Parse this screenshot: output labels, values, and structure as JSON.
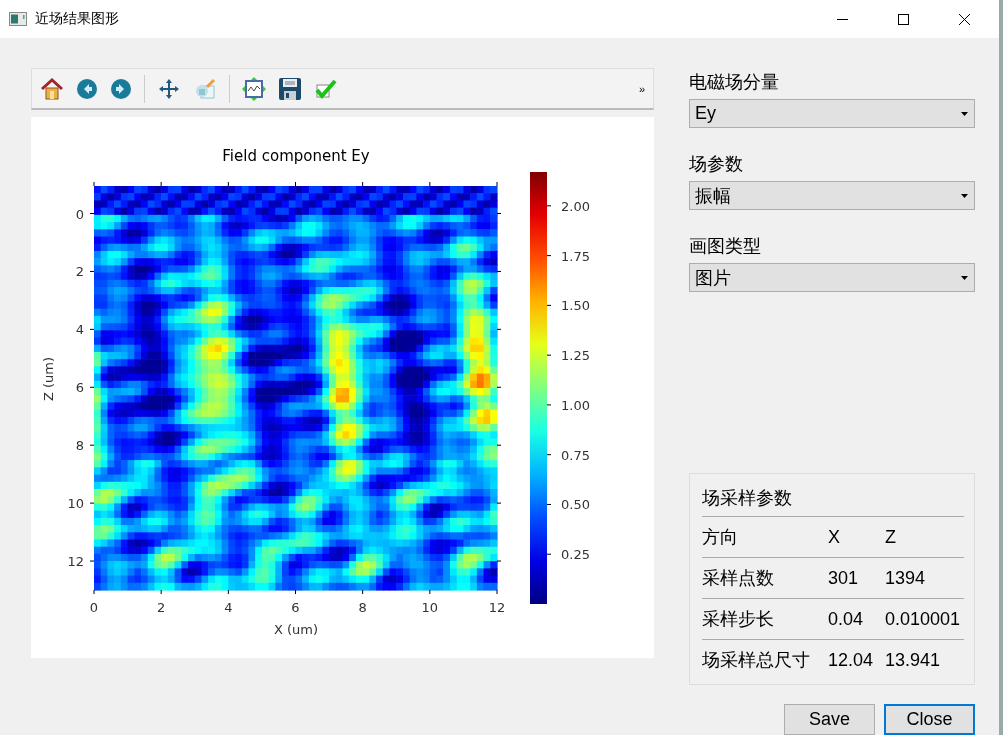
{
  "window": {
    "title": "近场结果图形"
  },
  "toolbar": {
    "items": [
      {
        "kind": "home"
      },
      {
        "kind": "back"
      },
      {
        "kind": "forward"
      },
      {
        "kind": "separator"
      },
      {
        "kind": "pan"
      },
      {
        "kind": "edit"
      },
      {
        "kind": "separator"
      },
      {
        "kind": "subplots"
      },
      {
        "kind": "save"
      },
      {
        "kind": "check"
      }
    ],
    "overflow": "»"
  },
  "plot": {
    "title": "Field component Ey",
    "xlabel": "X (um)",
    "ylabel": "Z (um)",
    "xticks": [
      "0",
      "2",
      "4",
      "6",
      "8",
      "10",
      "12"
    ],
    "yticks": [
      "0",
      "2",
      "4",
      "6",
      "8",
      "10",
      "12"
    ],
    "colorbar_ticks": [
      "2.00",
      "1.75",
      "1.50",
      "1.25",
      "1.00",
      "0.75",
      "0.50",
      "0.25"
    ]
  },
  "controls": [
    {
      "label": "电磁场分量",
      "value": "Ey"
    },
    {
      "label": "场参数",
      "value": "振幅"
    },
    {
      "label": "画图类型",
      "value": "图片"
    }
  ],
  "sampling": {
    "title": "场采样参数",
    "header": [
      "方向",
      "X",
      "Z"
    ],
    "rows": [
      [
        "采样点数",
        "301",
        "1394"
      ],
      [
        "采样步长",
        "0.04",
        "0.010001"
      ],
      [
        "场采样总尺寸",
        "12.04",
        "13.941"
      ]
    ]
  },
  "buttons": [
    {
      "label": "Save",
      "focused": false
    },
    {
      "label": "Close",
      "focused": true
    }
  ]
}
